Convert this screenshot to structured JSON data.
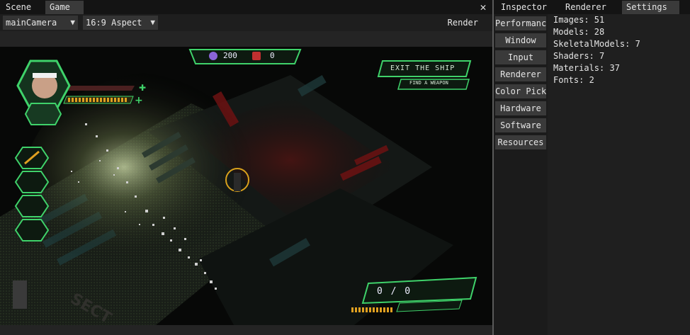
{
  "left_tabs": [
    {
      "label": "Scene",
      "active": false
    },
    {
      "label": "Game",
      "active": true
    }
  ],
  "close_glyph": "✕",
  "toolbar": {
    "camera": {
      "value": "mainCamera",
      "arrow": "▼"
    },
    "aspect": {
      "value": "16:9 Aspect",
      "arrow": "▼"
    },
    "render_label": "Render"
  },
  "right_tabs": [
    {
      "label": "Inspector",
      "active": false
    },
    {
      "label": "Renderer",
      "active": false
    },
    {
      "label": "Settings",
      "active": true
    }
  ],
  "categories": [
    "Performance",
    "Window",
    "Input",
    "Renderer",
    "Color Pick",
    "Hardware",
    "Software",
    "Resources"
  ],
  "resources": [
    "Images: 51",
    "Models: 28",
    "SkeletalModels: 7",
    "Shaders: 7",
    "Materials: 37",
    "Fonts: 2"
  ],
  "game_hud": {
    "credits": "200",
    "kills": "0",
    "objective": "EXIT THE SHIP",
    "sub_objective": "FIND A WEAPON",
    "ammo": "0 / 0",
    "hud_color": "#3fd26a",
    "accent_color": "#e0a020"
  }
}
